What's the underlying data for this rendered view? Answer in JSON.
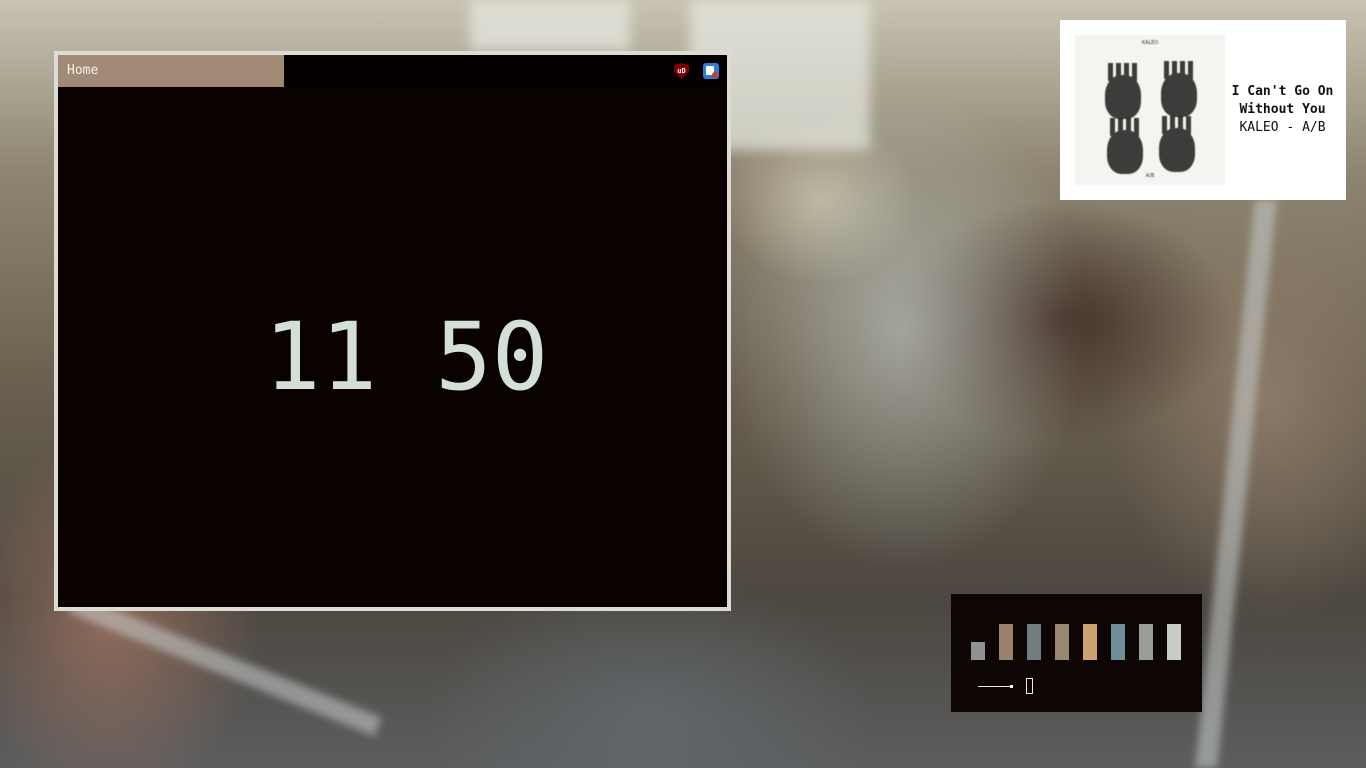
{
  "browser": {
    "tab_label": "Home",
    "clock": {
      "hours": "11",
      "minutes": "50"
    },
    "extensions": [
      {
        "icon": "ublock-origin-icon",
        "label": "uD"
      },
      {
        "icon": "extension-icon"
      }
    ]
  },
  "now_playing": {
    "album_art_band": "KALEO",
    "album_art_title": "A/B",
    "title": "I Can't Go On Without You",
    "artist_album": "KALEO - A/B"
  },
  "palette": {
    "swatches": [
      "#9ea3a1",
      "#a88f7a",
      "#7c8a8d",
      "#a6977f",
      "#e3b37c",
      "#7c9ea6",
      "#a7aea9",
      "#dbe2dd"
    ]
  },
  "colors": {
    "terminal_bg": "#090201",
    "tab_active": "#a08a75",
    "clock_fg": "#d4e0d6",
    "window_border": "#dcdcd5"
  }
}
